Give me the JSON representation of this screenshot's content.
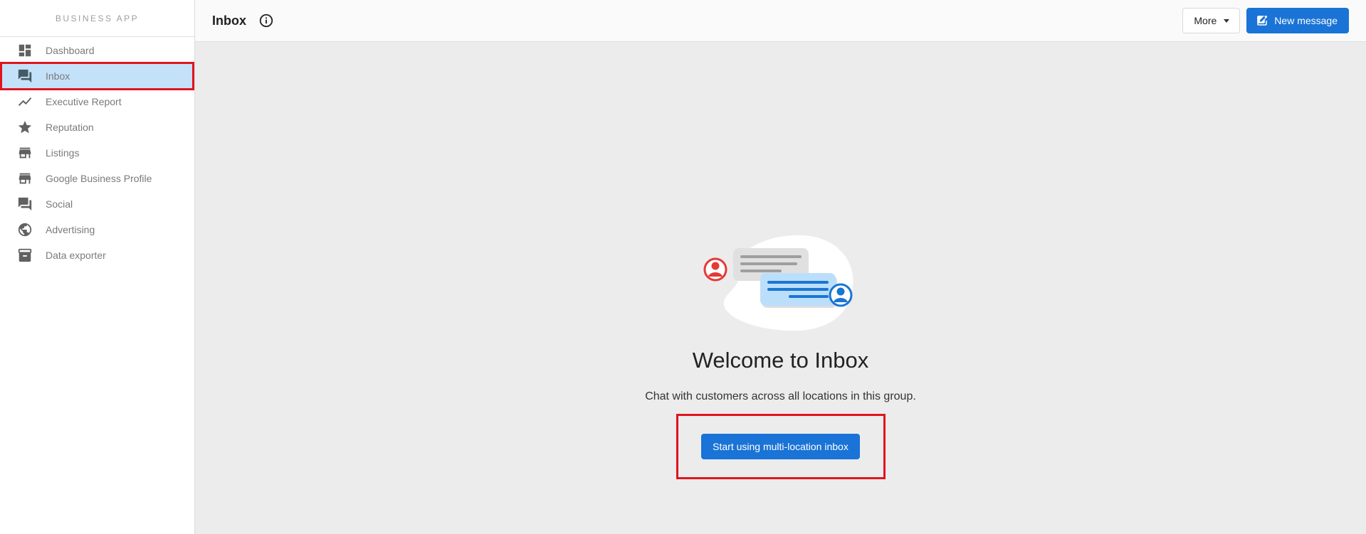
{
  "sidebar": {
    "brand": "BUSINESS APP",
    "items": [
      {
        "label": "Dashboard",
        "icon": "dashboard-icon"
      },
      {
        "label": "Inbox",
        "icon": "chat-icon",
        "active": true
      },
      {
        "label": "Executive Report",
        "icon": "trending-icon"
      },
      {
        "label": "Reputation",
        "icon": "star-icon"
      },
      {
        "label": "Listings",
        "icon": "store-icon"
      },
      {
        "label": "Google Business Profile",
        "icon": "store-icon"
      },
      {
        "label": "Social",
        "icon": "chat-icon"
      },
      {
        "label": "Advertising",
        "icon": "globe-icon"
      },
      {
        "label": "Data exporter",
        "icon": "archive-icon"
      }
    ]
  },
  "header": {
    "title": "Inbox",
    "info_icon": "info-icon",
    "more_label": "More",
    "new_message_label": "New message",
    "new_message_icon": "edit-icon"
  },
  "empty_state": {
    "title": "Welcome to Inbox",
    "subtitle": "Chat with customers across all locations in this group.",
    "cta_label": "Start using multi-location inbox"
  },
  "colors": {
    "accent": "#1a73d6",
    "active_nav_bg": "#c4e1fa",
    "highlight": "#e0151c",
    "avatar_red": "#e53935",
    "avatar_blue": "#1976d2"
  }
}
